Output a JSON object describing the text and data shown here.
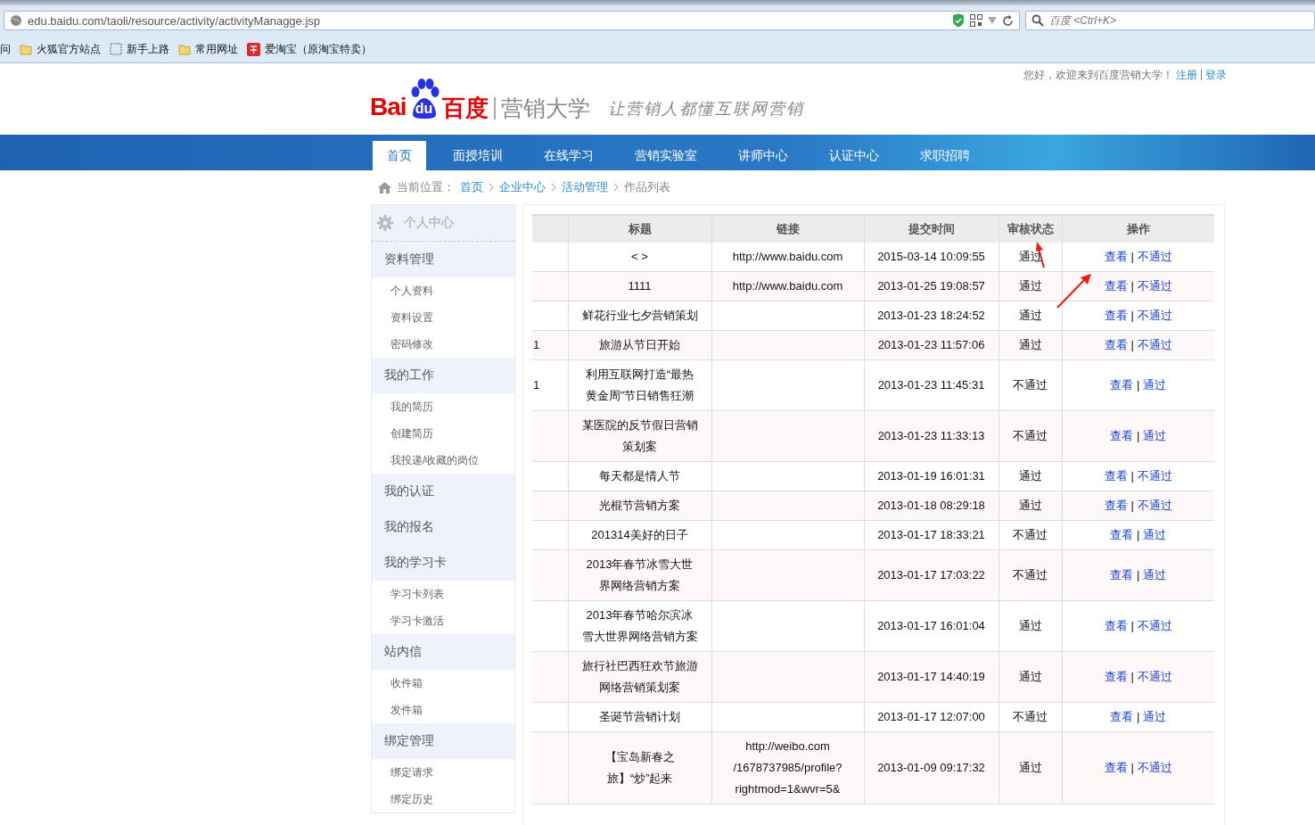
{
  "browser": {
    "url": "edu.baidu.com/taoli/resource/activity/activityManagge.jsp",
    "search": {
      "placeholder": "百度 <Ctrl+K>"
    },
    "bookmarks": [
      {
        "label": "问",
        "kind": "none"
      },
      {
        "label": "火狐官方站点",
        "kind": "folder"
      },
      {
        "label": "新手上路",
        "kind": "page"
      },
      {
        "label": "常用网址",
        "kind": "folder"
      },
      {
        "label": "爱淘宝（原淘宝特卖）",
        "kind": "shop"
      }
    ]
  },
  "header": {
    "welcome": "您好，欢迎来到百度营销大学！",
    "register": "注册",
    "separator": "|",
    "login": "登录",
    "logo": {
      "bai": "Bai",
      "du": "du",
      "baidu_cn": "百度",
      "product": "营销大学",
      "slogan": "让营销人都懂互联网营销"
    }
  },
  "nav": [
    {
      "label": "首页",
      "selected": true
    },
    {
      "label": "面授培训",
      "selected": false
    },
    {
      "label": "在线学习",
      "selected": false
    },
    {
      "label": "营销实验室",
      "selected": false
    },
    {
      "label": "讲师中心",
      "selected": false
    },
    {
      "label": "认证中心",
      "selected": false
    },
    {
      "label": "求职招聘",
      "selected": false
    }
  ],
  "breadcrumb": {
    "prefix": "当前位置：",
    "links": [
      "首页",
      "企业中心",
      "活动管理"
    ],
    "current": "作品列表"
  },
  "sidebar": {
    "title": "个人中心",
    "groups": [
      {
        "label": "资料管理",
        "children": [
          "个人资料",
          "资料设置",
          "密码修改"
        ]
      },
      {
        "label": "我的工作",
        "children": [
          "我的简历",
          "创建简历",
          "我投递/收藏的岗位"
        ]
      },
      {
        "label": "我的认证"
      },
      {
        "label": "我的报名"
      },
      {
        "label": "我的学习卡",
        "children": [
          "学习卡列表",
          "学习卡激活"
        ]
      },
      {
        "label": "站内信",
        "children": [
          "收件箱",
          "发件箱"
        ]
      },
      {
        "label": "绑定管理",
        "children": [
          "绑定请求",
          "绑定历史"
        ]
      }
    ]
  },
  "table": {
    "columns": [
      "标题",
      "链接",
      "提交时间",
      "审核状态",
      "操作"
    ],
    "rows": [
      {
        "title": "< >",
        "link": "http://www.baidu.com",
        "time": "2015-03-14 10:09:55",
        "status": "通过",
        "actions": [
          "查看",
          "不通过"
        ],
        "separator": "|"
      },
      {
        "title": "1111",
        "link": "http://www.baidu.com",
        "time": "2013-01-25 19:08:57",
        "status": "通过",
        "actions": [
          "查看",
          "不通过"
        ],
        "separator": "|"
      },
      {
        "title": "鲜花行业七夕营销策划",
        "time": "2013-01-23 18:24:52",
        "status": "通过",
        "actions": [
          "查看",
          "不通过"
        ],
        "separator": "|"
      },
      {
        "column_1": "1",
        "title": "旅游从节日开始",
        "time": "2013-01-23 11:57:06",
        "status": "通过",
        "actions": [
          "查看",
          "不通过"
        ],
        "separator": "|"
      },
      {
        "column_1": "1",
        "title": "利用互联网打造“最热黄金周”节日销售狂潮",
        "time": "2013-01-23 11:45:31",
        "status": "不通过",
        "actions": [
          "查看",
          "通过"
        ],
        "separator": "|"
      },
      {
        "title": "某医院的反节假日营销策划案",
        "time": "2013-01-23 11:33:13",
        "status": "不通过",
        "actions": [
          "查看",
          "通过"
        ],
        "separator": "|"
      },
      {
        "title": "每天都是情人节",
        "time": "2013-01-19 16:01:31",
        "status": "通过",
        "actions": [
          "查看",
          "不通过"
        ],
        "separator": "|"
      },
      {
        "title": "光棍节营销方案",
        "time": "2013-01-18 08:29:18",
        "status": "通过",
        "actions": [
          "查看",
          "不通过"
        ],
        "separator": "|"
      },
      {
        "title": "201314美好的日子",
        "time": "2013-01-17 18:33:21",
        "status": "不通过",
        "actions": [
          "查看",
          "通过"
        ],
        "separator": "|"
      },
      {
        "title": "2013年春节冰雪大世界网络营销方案",
        "time": "2013-01-17 17:03:22",
        "status": "不通过",
        "actions": [
          "查看",
          "通过"
        ],
        "separator": "|"
      },
      {
        "title": "2013年春节哈尔滨冰雪大世界网络营销方案",
        "time": "2013-01-17 16:01:04",
        "status": "通过",
        "actions": [
          "查看",
          "不通过"
        ],
        "separator": "|"
      },
      {
        "title": "旅行社巴西狂欢节旅游网络营销策划案",
        "time": "2013-01-17 14:40:19",
        "status": "通过",
        "actions": [
          "查看",
          "不通过"
        ],
        "separator": "|"
      },
      {
        "title": "圣诞节营销计划",
        "time": "2013-01-17 12:07:00",
        "status": "不通过",
        "actions": [
          "查看",
          "通过"
        ],
        "separator": "|"
      },
      {
        "title": "【宝岛新春之旅】“炒”起来",
        "link": "http://weibo.com/1678737985/profile?rightmod=1&wvr=5&",
        "time": "2013-01-09 09:17:32",
        "status": "通过",
        "actions": [
          "查看",
          "不通过"
        ],
        "separator": "|"
      }
    ]
  }
}
